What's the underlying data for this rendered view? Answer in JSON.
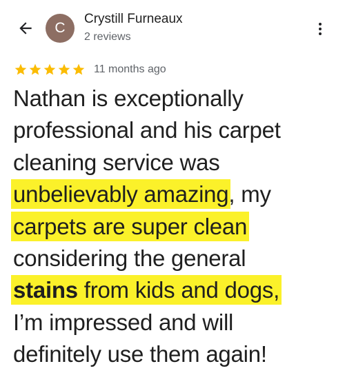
{
  "header": {
    "reviewer_initial": "C",
    "reviewer_name": "Crystill Furneaux",
    "reviewer_meta": "2 reviews"
  },
  "rating": {
    "stars": 5,
    "max_stars": 5,
    "date": "11 months ago"
  },
  "review": {
    "l1": "Nathan is exceptionally",
    "l2": "professional and his carpet",
    "l3": "cleaning service was",
    "l4_hl": "unbelievably amazing",
    "l4_rest": ", my",
    "l5_hl": "carpets are super clean",
    "l6": "considering the general",
    "l7_bold": "stains",
    "l7_hl": " from kids and dogs,",
    "l8": "I’m impressed and will",
    "l9": "definitely use them again!"
  },
  "colors": {
    "highlight": "#fbf12a",
    "star": "#fbbc04",
    "avatar": "#8d6e63"
  },
  "icons": {
    "back": "arrow-left-icon",
    "more": "more-vert-icon",
    "star": "star-icon"
  }
}
